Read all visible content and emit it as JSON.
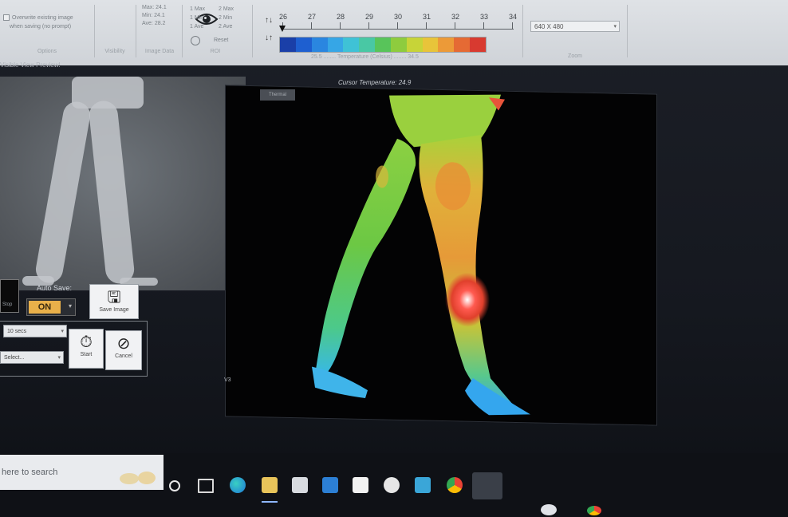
{
  "ribbon": {
    "group1": {
      "check1": "Overwrite existing image",
      "check2": "when saving (no prompt)",
      "caption": "Options"
    },
    "eye_caption": "Visibility",
    "stats": {
      "max": "Max: 24.1",
      "min": "Min: 24.1",
      "ave": "Ave: 28.2",
      "caption": "Image Data"
    },
    "roi": {
      "max": "1 Max",
      "min": "1 Min",
      "ave": "1 Ave",
      "max2": "2 Max",
      "min2": "2 Min",
      "ave2": "2 Ave",
      "reset": "Reset",
      "caption": "ROI"
    },
    "scale": {
      "ticks": [
        "26",
        "27",
        "28",
        "29",
        "30",
        "31",
        "32",
        "33",
        "34"
      ],
      "caption": "25.5 ........ Temperature (Celsius) ........ 34.5"
    },
    "resolution": {
      "value": "640 X 480",
      "caption": "Zoom"
    }
  },
  "left": {
    "pane_title": "Visible View Preview!",
    "auto_save_label": "Auto Save:",
    "auto_save_value": "ON",
    "save_image_label": "Save Image",
    "interval_select": "10 secs",
    "mode_select": "Select...",
    "start_label": "Start",
    "cancel_label": "Cancel",
    "black_btn_label": "Stop"
  },
  "thermal": {
    "cursor_temp": "Cursor Temperature: 24.9",
    "badge": "Thermal",
    "corner_label": "V3"
  },
  "taskbar": {
    "search_placeholder": "here to search"
  },
  "colors": {
    "colorbar": [
      "#1a3fa8",
      "#1e5fd0",
      "#2a86e0",
      "#36a6e6",
      "#3fc2d6",
      "#49c8a4",
      "#58c45a",
      "#8ecc3e",
      "#c7d438",
      "#e8c43a",
      "#ec9a38",
      "#e56a34",
      "#d83a30"
    ]
  }
}
